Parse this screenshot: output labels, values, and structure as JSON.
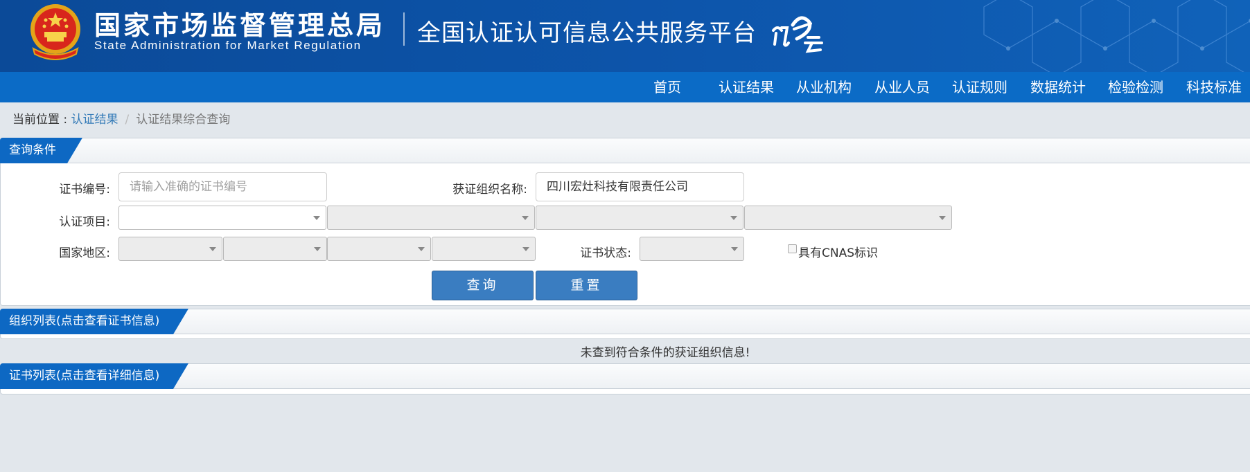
{
  "header": {
    "org_name_cn": "国家市场监督管理总局",
    "org_name_en": "State Administration for Market Regulation",
    "platform_title": "全国认证认可信息公共服务平台",
    "logo_text": "认云"
  },
  "nav": {
    "items": [
      "首页",
      "认证结果",
      "从业机构",
      "从业人员",
      "认证规则",
      "数据统计",
      "检验检测",
      "科技标准"
    ]
  },
  "breadcrumb": {
    "prefix": "当前位置 : ",
    "link": "认证结果",
    "separator": "/",
    "current": "认证结果综合查询"
  },
  "query_panel": {
    "title": "查询条件",
    "cert_no_label": "证书编号:",
    "cert_no_placeholder": "请输入准确的证书编号",
    "org_name_label": "获证组织名称:",
    "org_name_value": "四川宏灶科技有限责任公司",
    "project_label": "认证项目:",
    "region_label": "国家地区:",
    "status_label": "证书状态:",
    "cnas_label": "具有CNAS标识",
    "cnas_checked": false,
    "search_button": "查询",
    "reset_button": "重置"
  },
  "org_panel": {
    "title": "组织列表(点击查看证书信息)",
    "empty_message": "未查到符合条件的获证组织信息!"
  },
  "cert_panel": {
    "title": "证书列表(点击查看详细信息)"
  },
  "colors": {
    "header_bg": "#0d55ab",
    "nav_bg": "#0b6bc6",
    "tab_bg": "#0d68c3",
    "button_bg": "#3a7dc1",
    "page_bg": "#e2e7ec",
    "link": "#337ab7"
  }
}
